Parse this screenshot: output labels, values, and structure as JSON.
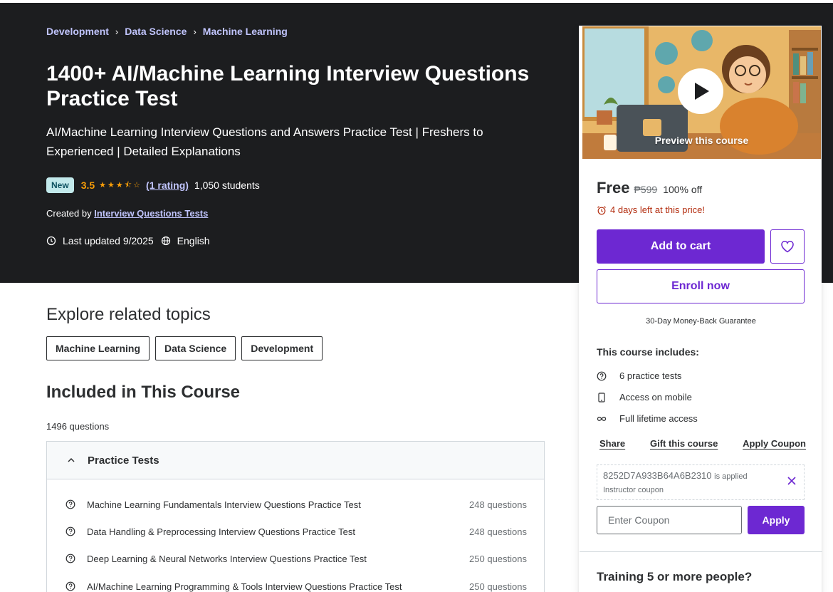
{
  "breadcrumb": [
    "Development",
    "Data Science",
    "Machine Learning"
  ],
  "course": {
    "title": "1400+ AI/Machine Learning Interview Questions Practice Test",
    "subtitle": "AI/Machine Learning Interview Questions and Answers Practice Test | Freshers to Experienced | Detailed Explanations",
    "badge": "New",
    "rating": "3.5",
    "rating_value": 3.5,
    "rating_count": "(1 rating)",
    "students": "1,050 students",
    "created_by_label": "Created by",
    "author": "Interview Questions Tests",
    "last_updated": "Last updated 9/2025",
    "language": "English"
  },
  "explore": {
    "heading": "Explore related topics",
    "topics": [
      "Machine Learning",
      "Data Science",
      "Development"
    ]
  },
  "included": {
    "heading": "Included in This Course",
    "question_count": "1496 questions",
    "section_title": "Practice Tests",
    "tests": [
      {
        "name": "Machine Learning Fundamentals Interview Questions Practice Test",
        "count": "248 questions"
      },
      {
        "name": "Data Handling & Preprocessing Interview Questions Practice Test",
        "count": "248 questions"
      },
      {
        "name": "Deep Learning & Neural Networks Interview Questions Practice Test",
        "count": "250 questions"
      },
      {
        "name": "AI/Machine Learning Programming & Tools Interview Questions Practice Test",
        "count": "250 questions"
      }
    ]
  },
  "sidebar": {
    "preview_label": "Preview this course",
    "price": "Free",
    "original_price": "₱599",
    "discount": "100% off",
    "deadline": "4 days left at this price!",
    "add_to_cart": "Add to cart",
    "enroll_now": "Enroll now",
    "guarantee": "30-Day Money-Back Guarantee",
    "includes_heading": "This course includes:",
    "includes": [
      "6 practice tests",
      "Access on mobile",
      "Full lifetime access"
    ],
    "links": {
      "share": "Share",
      "gift": "Gift this course",
      "apply_coupon": "Apply Coupon"
    },
    "coupon_code": "8252D7A933B64A6B2310",
    "coupon_applied_suffix": "is applied",
    "coupon_type": "Instructor coupon",
    "coupon_placeholder": "Enter Coupon",
    "apply_label": "Apply",
    "training_heading": "Training 5 or more people?"
  },
  "colors": {
    "hero_bg": "#1c1d1f",
    "accent_purple": "#6d28d2",
    "link_lavender": "#c0c4fc",
    "star_orange": "#f69c08",
    "deadline_red": "#b32d0f"
  }
}
